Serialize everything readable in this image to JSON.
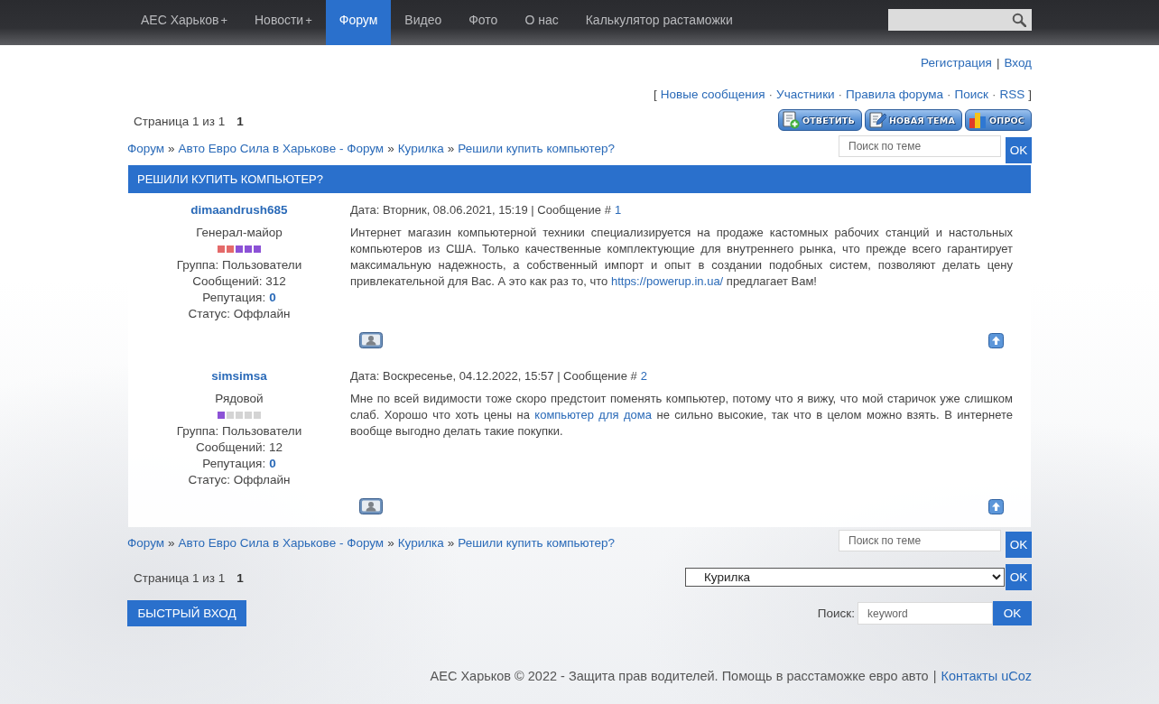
{
  "nav": {
    "items": [
      {
        "label": "АЕС Харьков",
        "submenu_mark": "+",
        "selected": false
      },
      {
        "label": "Новости",
        "submenu_mark": "+",
        "selected": false
      },
      {
        "label": "Форум",
        "selected": true
      },
      {
        "label": "Видео",
        "selected": false
      },
      {
        "label": "Фото",
        "selected": false
      },
      {
        "label": "О нас",
        "selected": false
      },
      {
        "label": "Калькулятор растаможки",
        "selected": false
      }
    ]
  },
  "auth_links": {
    "separator": "|",
    "items": [
      "Регистрация",
      "Вход"
    ]
  },
  "forum_links": {
    "open": "[",
    "close": "]",
    "separator": "·",
    "items": [
      "Новые сообщения",
      "Участники",
      "Правила форума",
      "Поиск",
      "RSS"
    ]
  },
  "pager_top": {
    "label": "Страница 1 из 1",
    "pages": [
      {
        "label": "1",
        "selected": true
      }
    ]
  },
  "action_buttons": [
    {
      "kind": "reply",
      "label": "ОТВЕТИТЬ"
    },
    {
      "kind": "new-topic",
      "label": "НОВАЯ ТЕМА"
    },
    {
      "kind": "poll",
      "label": "ОПРОС"
    }
  ],
  "breadcrumb_top": {
    "separator": "»",
    "items": [
      "Форум",
      "Авто Евро Сила в Харькове - Форум",
      "Курилка",
      "Решили купить компьютер?"
    ]
  },
  "topic_search_top": {
    "placeholder": "Поиск по теме",
    "button": "OK"
  },
  "topic_title": "РЕШИЛИ КУПИТЬ КОМПЬЮТЕР?",
  "posts": [
    {
      "author": "dimaandrush685",
      "rank": "Генерал-майор",
      "rank_marks": [
        {
          "color": "#e46a6a"
        },
        {
          "color": "#e46a6a"
        },
        {
          "color": "#8c52d6"
        },
        {
          "color": "#8c52d6"
        },
        {
          "color": "#8c52d6"
        }
      ],
      "details": [
        {
          "label": "Группа: Пользователи"
        },
        {
          "label": "Сообщений: 312"
        },
        {
          "label": "Репутация:",
          "value": "0"
        },
        {
          "label": "Статус: Оффлайн"
        }
      ],
      "date": "Дата: Вторник, 08.06.2021, 15:19 | Сообщение #",
      "number": "1",
      "body": [
        {
          "kind": "text",
          "text": "Интернет магазин компьютерной техники специализируется на продаже кастомных рабочих станций и настольных компьютеров из США. Только качественные комплектующие для внутреннего рынка, что прежде всего гарантирует максимальную надежность, а собственный импорт и опыт в создании подобных систем, позволяют делать цену привлекательной для Вас. А это как раз то, что "
        },
        {
          "kind": "link",
          "text": "https://powerup.in.ua/"
        },
        {
          "kind": "text",
          "text": " предлагает Вам!"
        }
      ]
    },
    {
      "author": "simsimsa",
      "rank": "Рядовой",
      "rank_marks": [
        {
          "color": "#8c52d6"
        },
        {
          "color": "#d4d4d4"
        },
        {
          "color": "#d4d4d4"
        },
        {
          "color": "#d4d4d4"
        },
        {
          "color": "#d4d4d4"
        }
      ],
      "details": [
        {
          "label": "Группа: Пользователи"
        },
        {
          "label": "Сообщений: 12"
        },
        {
          "label": "Репутация:",
          "value": "0"
        },
        {
          "label": "Статус: Оффлайн"
        }
      ],
      "date": "Дата: Воскресенье, 04.12.2022, 15:57 | Сообщение #",
      "number": "2",
      "body": [
        {
          "kind": "text",
          "text": "Мне по всей видимости тоже скоро предстоит поменять компьютер, потому что я вижу, что мой старичок уже слишком слаб. Хорошо что хоть цены на "
        },
        {
          "kind": "link",
          "text": "компьютер для дома"
        },
        {
          "kind": "text",
          "text": " не сильно высокие, так что в целом можно взять. В интернете вообще выгодно делать такие покупки."
        }
      ]
    }
  ],
  "breadcrumb_bottom": {
    "separator": "»",
    "items": [
      "Форум",
      "Авто Евро Сила в Харькове - Форум",
      "Курилка",
      "Решили купить компьютер?"
    ]
  },
  "topic_search_bottom": {
    "placeholder": "Поиск по теме",
    "button": "OK"
  },
  "pager_bottom": {
    "label": "Страница 1 из 1",
    "pages": [
      {
        "label": "1",
        "selected": true
      }
    ]
  },
  "forum_jump": {
    "value": "Курилка",
    "button": "OK"
  },
  "quick_login_button": "БЫСТРЫЙ ВХОД",
  "site_search": {
    "label": "Поиск:",
    "placeholder": "keyword",
    "button": "OK"
  },
  "footer": {
    "text": "АЕС Харьков © 2022 - Защита прав водителей. Помощь в расстаможке евро авто",
    "separator": "|",
    "links": [
      "Контакты",
      "uCoz"
    ]
  }
}
